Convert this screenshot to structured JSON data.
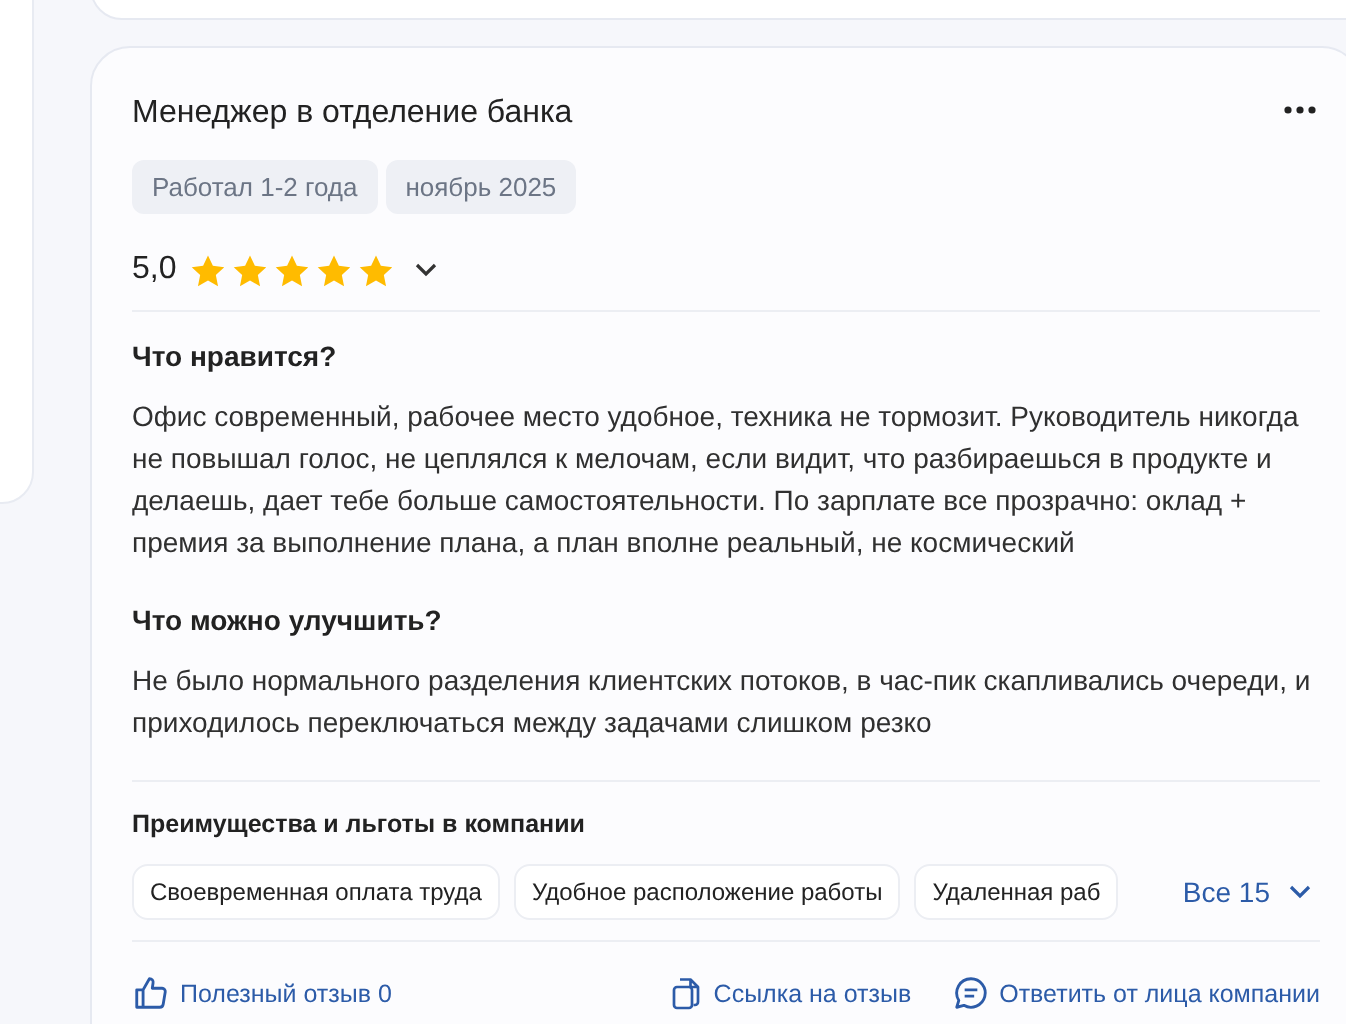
{
  "review": {
    "title": "Менеджер в отделение банка",
    "tags": [
      "Работал 1-2 года",
      "ноябрь 2025"
    ],
    "rating": "5,0",
    "stars": 5,
    "sections": [
      {
        "heading": "Что нравится?",
        "text": "Офис современный, рабочее место удобное, техника не тормозит. Руководитель никогда не повышал голос, не цеплялся к мелочам, если видит, что разбираешься в продукте и делаешь, дает тебе больше самостоятельности. По зарплате все прозрачно: оклад + премия за выполнение плана, а план вполне реальный, не космический"
      },
      {
        "heading": "Что можно улучшить?",
        "text": "Не было нормального разделения клиентских потоков, в час-пик скапливались очереди, и приходилось переключаться между задачами слишком резко"
      }
    ],
    "benefits": {
      "heading": "Преимущества и льготы в компании",
      "items": [
        "Своевременная оплата труда",
        "Удобное расположение работы",
        "Удаленная раб"
      ],
      "more": "Все 15"
    },
    "actions": [
      {
        "kind": "like",
        "label": "Полезный отзыв 0"
      },
      {
        "kind": "link",
        "label": "Ссылка на отзыв"
      },
      {
        "kind": "reply",
        "label": "Ответить от лица компании"
      }
    ]
  }
}
